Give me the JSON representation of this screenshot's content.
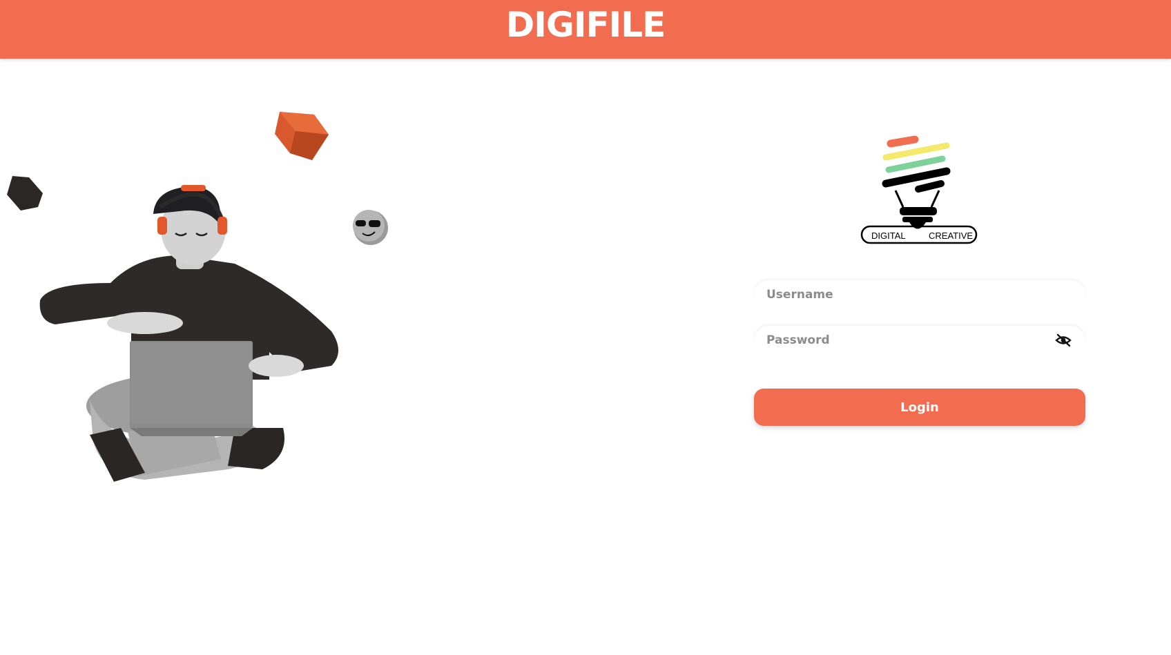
{
  "header": {
    "title": "DIGIFILE"
  },
  "logo": {
    "left_text": "DIGITAL",
    "right_text": "CREATIVE",
    "stripe_colors": [
      "#F26C4F",
      "#F4E96A",
      "#7FD19A",
      "#000000"
    ]
  },
  "form": {
    "username_placeholder": "Username",
    "password_placeholder": "Password",
    "password_toggle_icon": "eye-off-icon",
    "login_label": "Login"
  },
  "colors": {
    "accent": "#F26C4F"
  }
}
